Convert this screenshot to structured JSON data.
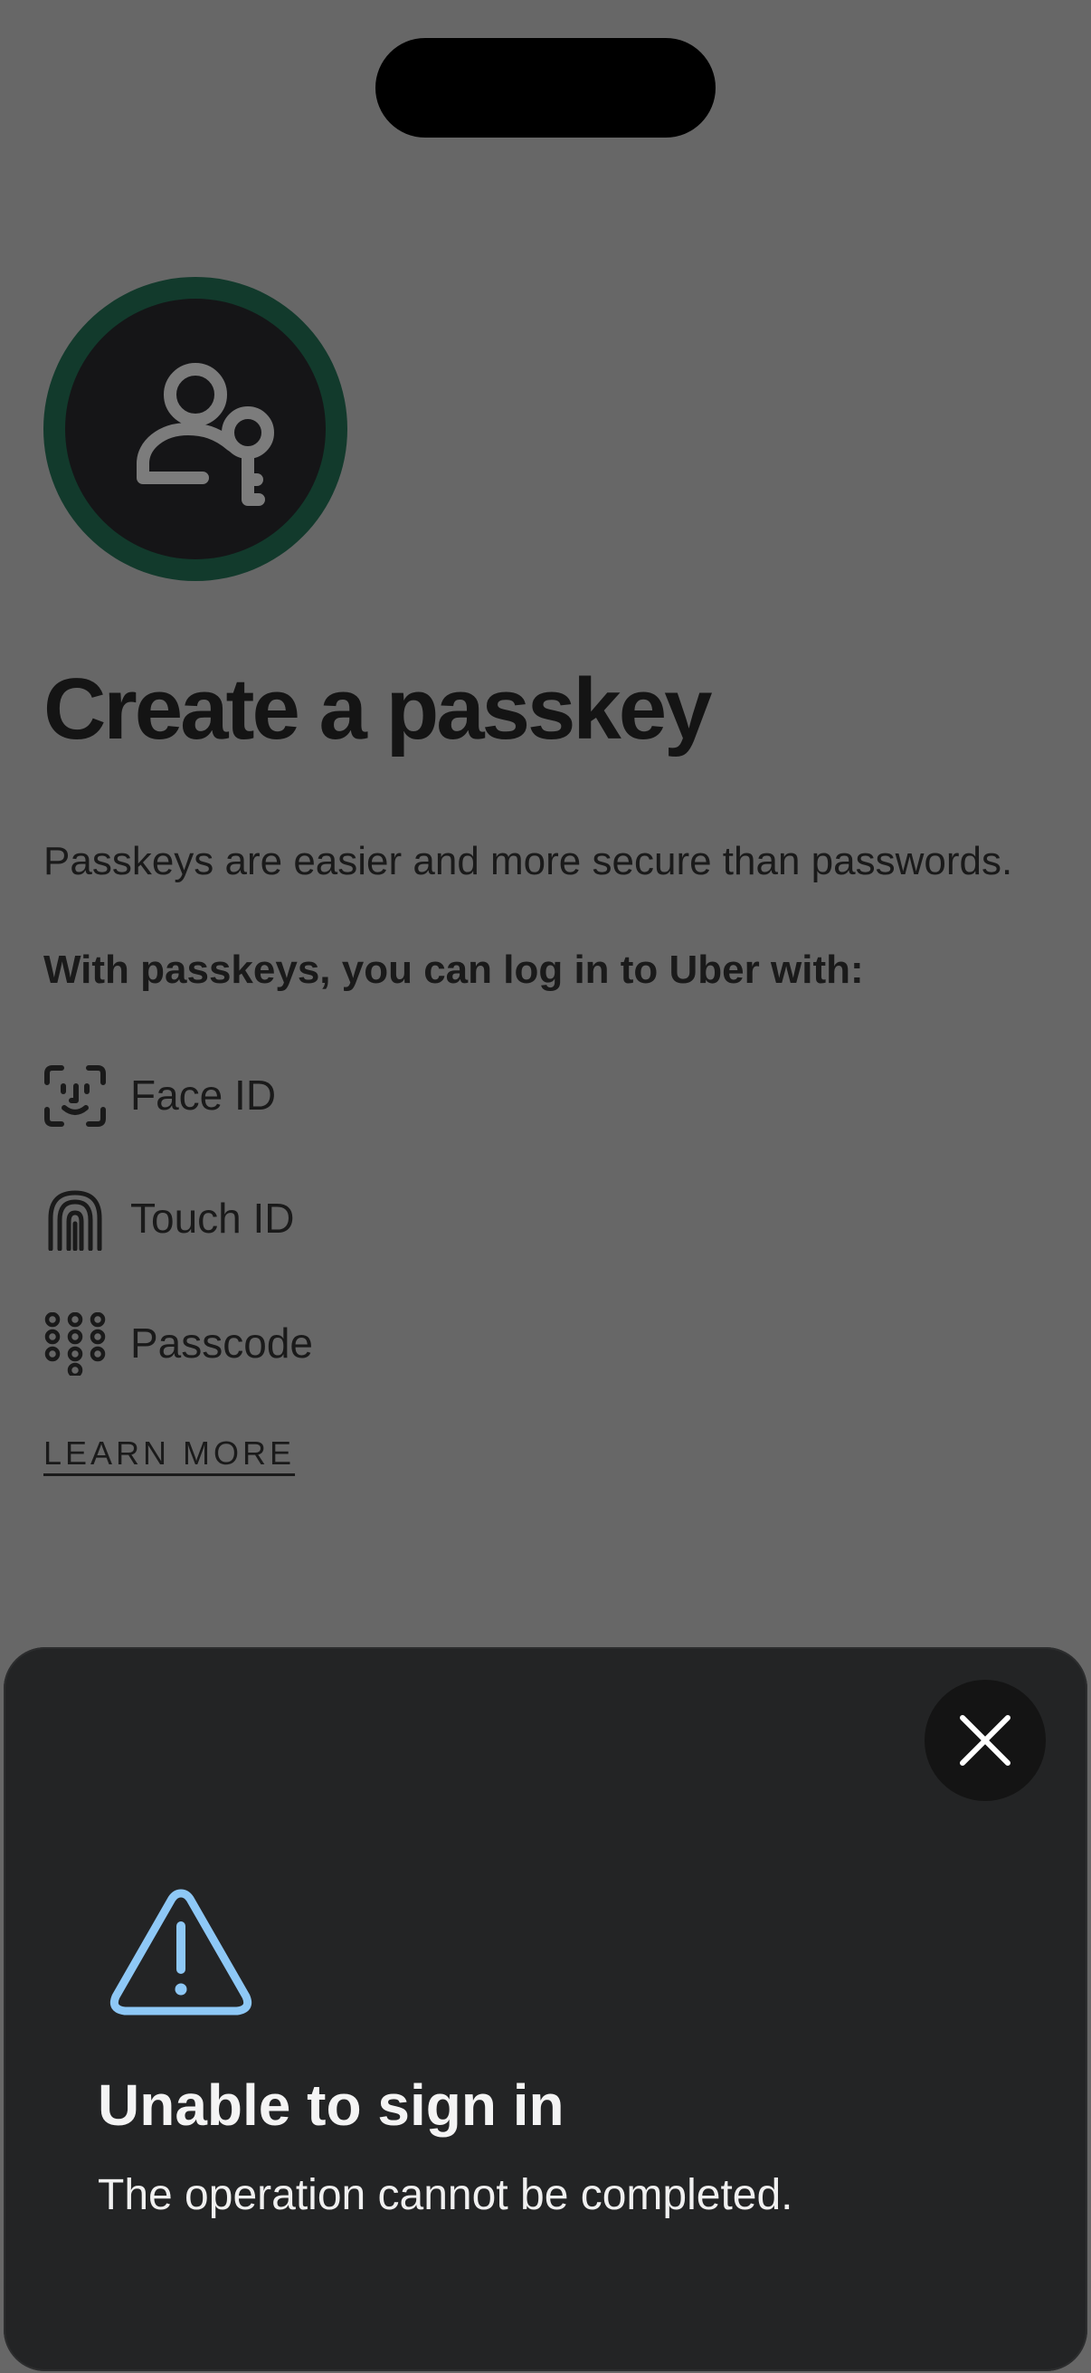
{
  "colors": {
    "dimmed_background": "#676767",
    "hero_ring": "#123a2c",
    "hero_fill": "#151517",
    "sheet_background": "#232425",
    "warning_icon": "#8ec8f6"
  },
  "page": {
    "title": "Create a passkey",
    "subtitle": "Passkeys are easier and more secure than passwords.",
    "lead": "With passkeys, you can log in to Uber with:",
    "hero_icon": "person-key-icon",
    "methods": [
      {
        "icon": "face-id-icon",
        "label": "Face ID"
      },
      {
        "icon": "fingerprint-icon",
        "label": "Touch ID"
      },
      {
        "icon": "keypad-icon",
        "label": "Passcode"
      }
    ],
    "learn_more": "LEARN MORE"
  },
  "alert": {
    "icon": "warning-icon",
    "close_icon": "close-icon",
    "title": "Unable to sign in",
    "message": "The operation cannot be completed."
  }
}
